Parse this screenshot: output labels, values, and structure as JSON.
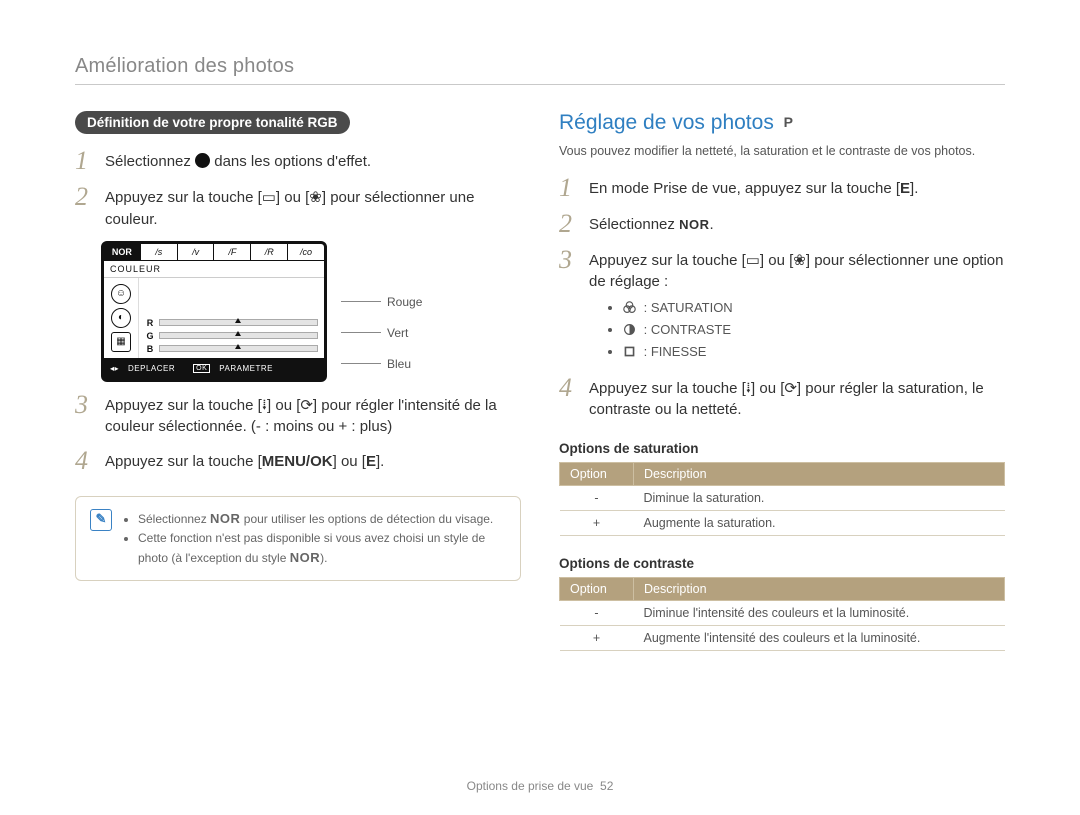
{
  "header": {
    "title": "Amélioration des photos"
  },
  "left": {
    "pill": "Définition de votre propre tonalité RGB",
    "step1_a": "Sélectionnez ",
    "step1_b": " dans les options d'effet.",
    "step2": "Appuyez sur la touche [▭] ou [❀] pour sélectionner une couleur.",
    "lcd": {
      "tab_active": "NOR",
      "label": "COULEUR",
      "r": "R",
      "g": "G",
      "b": "B",
      "foot_move": "DEPLACER",
      "foot_set": "PARAMETRE",
      "ok": "OK"
    },
    "legend": {
      "r": "Rouge",
      "g": "Vert",
      "b": "Bleu"
    },
    "step3": "Appuyez sur la touche [⭭] ou [⟳] pour régler l'intensité de la couleur sélectionnée. (- : moins ou + : plus)",
    "step4_a": "Appuyez sur la touche [",
    "step4_menu": "MENU/OK",
    "step4_b": "] ou [",
    "step4_e": "E",
    "step4_c": "].",
    "note1_a": "Sélectionnez ",
    "note1_nor": "NOR",
    "note1_b": " pour utiliser les options de détection du visage.",
    "note2_a": "Cette fonction n'est pas disponible si vous avez choisi un style de photo (à l'exception du style ",
    "note2_nor": "NOR",
    "note2_b": ")."
  },
  "right": {
    "h2": "Réglage de vos photos",
    "mode": "P",
    "intro": "Vous pouvez modifier la netteté, la saturation et le contraste de vos photos.",
    "step1_a": "En mode Prise de vue, appuyez sur la touche [",
    "step1_e": "E",
    "step1_b": "].",
    "step2_a": "Sélectionnez ",
    "step2_nor": "NOR",
    "step2_b": ".",
    "step3": "Appuyez sur la touche [▭] ou [❀] pour sélectionner une option de réglage :",
    "bullets": {
      "sat": "SATURATION",
      "con": "CONTRASTE",
      "fin": "FINESSE"
    },
    "step4": "Appuyez sur la touche [⭭] ou [⟳] pour régler la saturation, le contraste ou la netteté.",
    "sat_title": "Options de saturation",
    "con_title": "Options de contraste",
    "th_opt": "Option",
    "th_desc": "Description",
    "sat_rows": [
      {
        "opt": "-",
        "desc": "Diminue la saturation."
      },
      {
        "opt": "+",
        "desc": "Augmente la saturation."
      }
    ],
    "con_rows": [
      {
        "opt": "-",
        "desc": "Diminue l'intensité des couleurs et la luminosité."
      },
      {
        "opt": "+",
        "desc": "Augmente l'intensité des couleurs et la luminosité."
      }
    ]
  },
  "footer": {
    "section": "Options de prise de vue",
    "page": "52"
  }
}
